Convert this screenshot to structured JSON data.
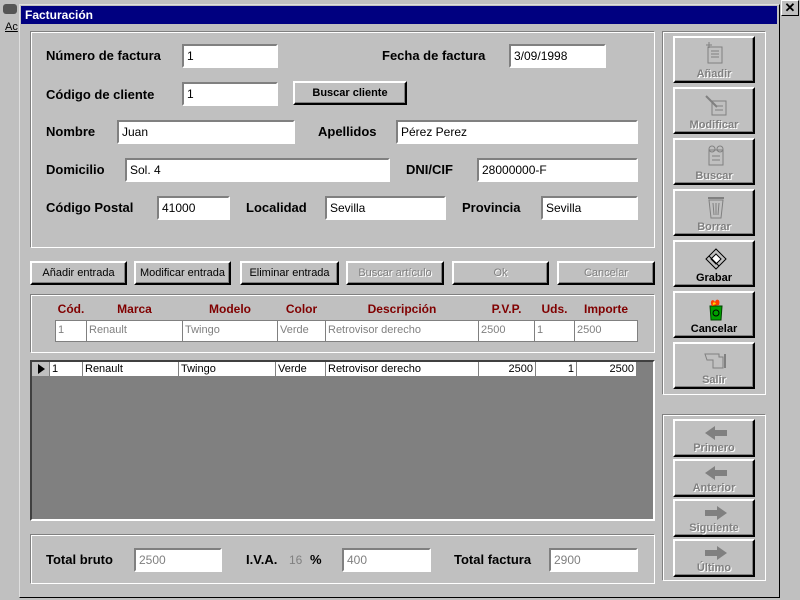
{
  "background_app": {
    "menu_fragment": "Ac"
  },
  "window": {
    "title": "Facturación"
  },
  "header": {
    "numero_factura": {
      "label": "Número de factura",
      "value": "1"
    },
    "fecha_factura": {
      "label": "Fecha de factura",
      "value": "3/09/1998"
    },
    "codigo_cliente": {
      "label": "Código de cliente",
      "value": "1"
    },
    "buscar_cliente_label": "Buscar cliente",
    "nombre": {
      "label": "Nombre",
      "value": "Juan"
    },
    "apellidos": {
      "label": "Apellidos",
      "value": "Pérez Perez"
    },
    "domicilio": {
      "label": "Domicilio",
      "value": "Sol. 4"
    },
    "dni": {
      "label": "DNI/CIF",
      "value": "28000000-F"
    },
    "codigo_postal": {
      "label": "Código Postal",
      "value": "41000"
    },
    "localidad": {
      "label": "Localidad",
      "value": "Sevilla"
    },
    "provincia": {
      "label": "Provincia",
      "value": "Sevilla"
    }
  },
  "entry_buttons": {
    "anadir": "Añadir entrada",
    "modificar": "Modificar entrada",
    "eliminar": "Eliminar entrada",
    "buscar_articulo": "Buscar artículo",
    "ok": "Ok",
    "cancelar": "Cancelar"
  },
  "entry": {
    "headers": {
      "cod": "Cód.",
      "marca": "Marca",
      "modelo": "Modelo",
      "color": "Color",
      "descripcion": "Descripción",
      "pvp": "P.V.P.",
      "uds": "Uds.",
      "importe": "Importe"
    },
    "values": {
      "cod": "1",
      "marca": "Renault",
      "modelo": "Twingo",
      "color": "Verde",
      "descripcion": "Retrovisor derecho",
      "pvp": "2500",
      "uds": "1",
      "importe": "2500"
    }
  },
  "grid": {
    "rows": [
      {
        "cod": "1",
        "marca": "Renault",
        "modelo": "Twingo",
        "color": "Verde",
        "descripcion": "Retrovisor derecho",
        "pvp": "2500",
        "uds": "1",
        "importe": "2500"
      }
    ]
  },
  "totals": {
    "total_bruto": {
      "label": "Total bruto",
      "value": "2500"
    },
    "iva": {
      "label": "I.V.A.",
      "rate": "16",
      "percent_sign": "%",
      "value": "400"
    },
    "total_factura": {
      "label": "Total factura",
      "value": "2900"
    }
  },
  "side_buttons": {
    "anadir": {
      "label": "Añadir",
      "icon": "add-document-icon"
    },
    "modificar": {
      "label": "Modificar",
      "icon": "edit-document-icon"
    },
    "buscar": {
      "label": "Buscar",
      "icon": "binoculars-icon"
    },
    "borrar": {
      "label": "Borrar",
      "icon": "trash-icon"
    },
    "grabar": {
      "label": "Grabar",
      "icon": "floppy-disk-icon"
    },
    "cancelar": {
      "label": "Cancelar",
      "icon": "cancel-bin-icon"
    },
    "salir": {
      "label": "Salir",
      "icon": "exit-hand-icon"
    }
  },
  "nav_buttons": {
    "primero": {
      "label": "Primero",
      "icon": "arrow-left-icon"
    },
    "anterior": {
      "label": "Anterior",
      "icon": "arrow-left-icon"
    },
    "siguiente": {
      "label": "Siguiente",
      "icon": "arrow-right-icon"
    },
    "ultimo": {
      "label": "Último",
      "icon": "arrow-right-icon"
    }
  },
  "colors": {
    "title_bar": "#000080",
    "header_label": "#800000",
    "face": "#c0c0c0",
    "cancel_icon_green": "#00a000",
    "cancel_icon_red": "#ff0000"
  }
}
